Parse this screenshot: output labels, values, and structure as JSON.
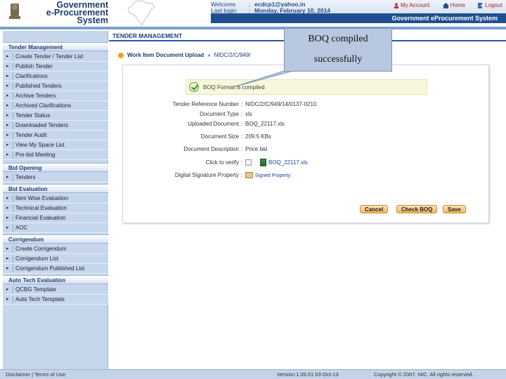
{
  "header": {
    "logo_lines": [
      "Government",
      "e-Procurement",
      "System"
    ],
    "emblem_caption": "सत्यमेव जयते",
    "welcome_label": "Welcome",
    "welcome_value": "ecdcp1@yahoo.in",
    "last_login_label": "Last login",
    "last_login_value": "Monday, February 10, 2014",
    "links": {
      "my_account": "My Account",
      "home": "Home",
      "logout": "Logout"
    },
    "system_title": "Government eProcurement System"
  },
  "sidebar": {
    "sections": [
      {
        "title": "Tender Management",
        "items": [
          "Create Tender / Tender List",
          "Publish Tender",
          "Clarifications",
          "Published Tenders",
          "Archive Tenders",
          "Archived Clarifications",
          "Tender Status",
          "Downloaded Tenders",
          "Tender Audit",
          "View My Space List",
          "Pre-bid Meeting"
        ]
      },
      {
        "title": "Bid Opening",
        "items": [
          "Tenders"
        ]
      },
      {
        "title": "Bid Evaluation",
        "items": [
          "Item Wise Evaluation",
          "Technical Evaluation",
          "Financial Evaluation",
          "AOC"
        ]
      },
      {
        "title": "Corrigendum",
        "items": [
          "Create Corrigendum",
          "Corrigendum List",
          "Corrigendum Published List"
        ]
      },
      {
        "title": "Auto Tech Evaluation",
        "items": [
          "QCBG Template",
          "Auto Tech Template"
        ]
      }
    ]
  },
  "main": {
    "page_title": "TENDER MANAGEMENT",
    "breadcrumb": {
      "current": "Work Item Document Upload",
      "separator": "»",
      "ref": "NIDC/2/C/949/"
    },
    "success_message": "BOQ Format is compiled",
    "details": [
      {
        "label": "Tender Reference Number",
        "value": "NIDC/2/C/949/14/0137-0210"
      },
      {
        "label": "Document Type",
        "value": "xls"
      },
      {
        "label": "Uploaded Document",
        "value": "BOQ_22117.xls"
      },
      {
        "label": "Document Size",
        "value": "209.5 KBs"
      },
      {
        "label": "Document Description",
        "value": "Price bid"
      },
      {
        "label": "Click to verify",
        "value": "BOQ_22117.xls"
      },
      {
        "label": "Digital Signature Property",
        "value": "Signed Property"
      }
    ],
    "buttons": {
      "cancel": "Cancel",
      "check_boq": "Check BOQ",
      "save": "Save"
    }
  },
  "callout": {
    "line1": "BOQ compiled",
    "line2": "successfully"
  },
  "footer": {
    "disclaimer": "Disclaimer",
    "separator": "|",
    "terms": "Terms of Use",
    "version": "Version:1.09.01 03-Oct-13",
    "copyright": "Copyright © 2007. NIC. All rights reserved."
  }
}
